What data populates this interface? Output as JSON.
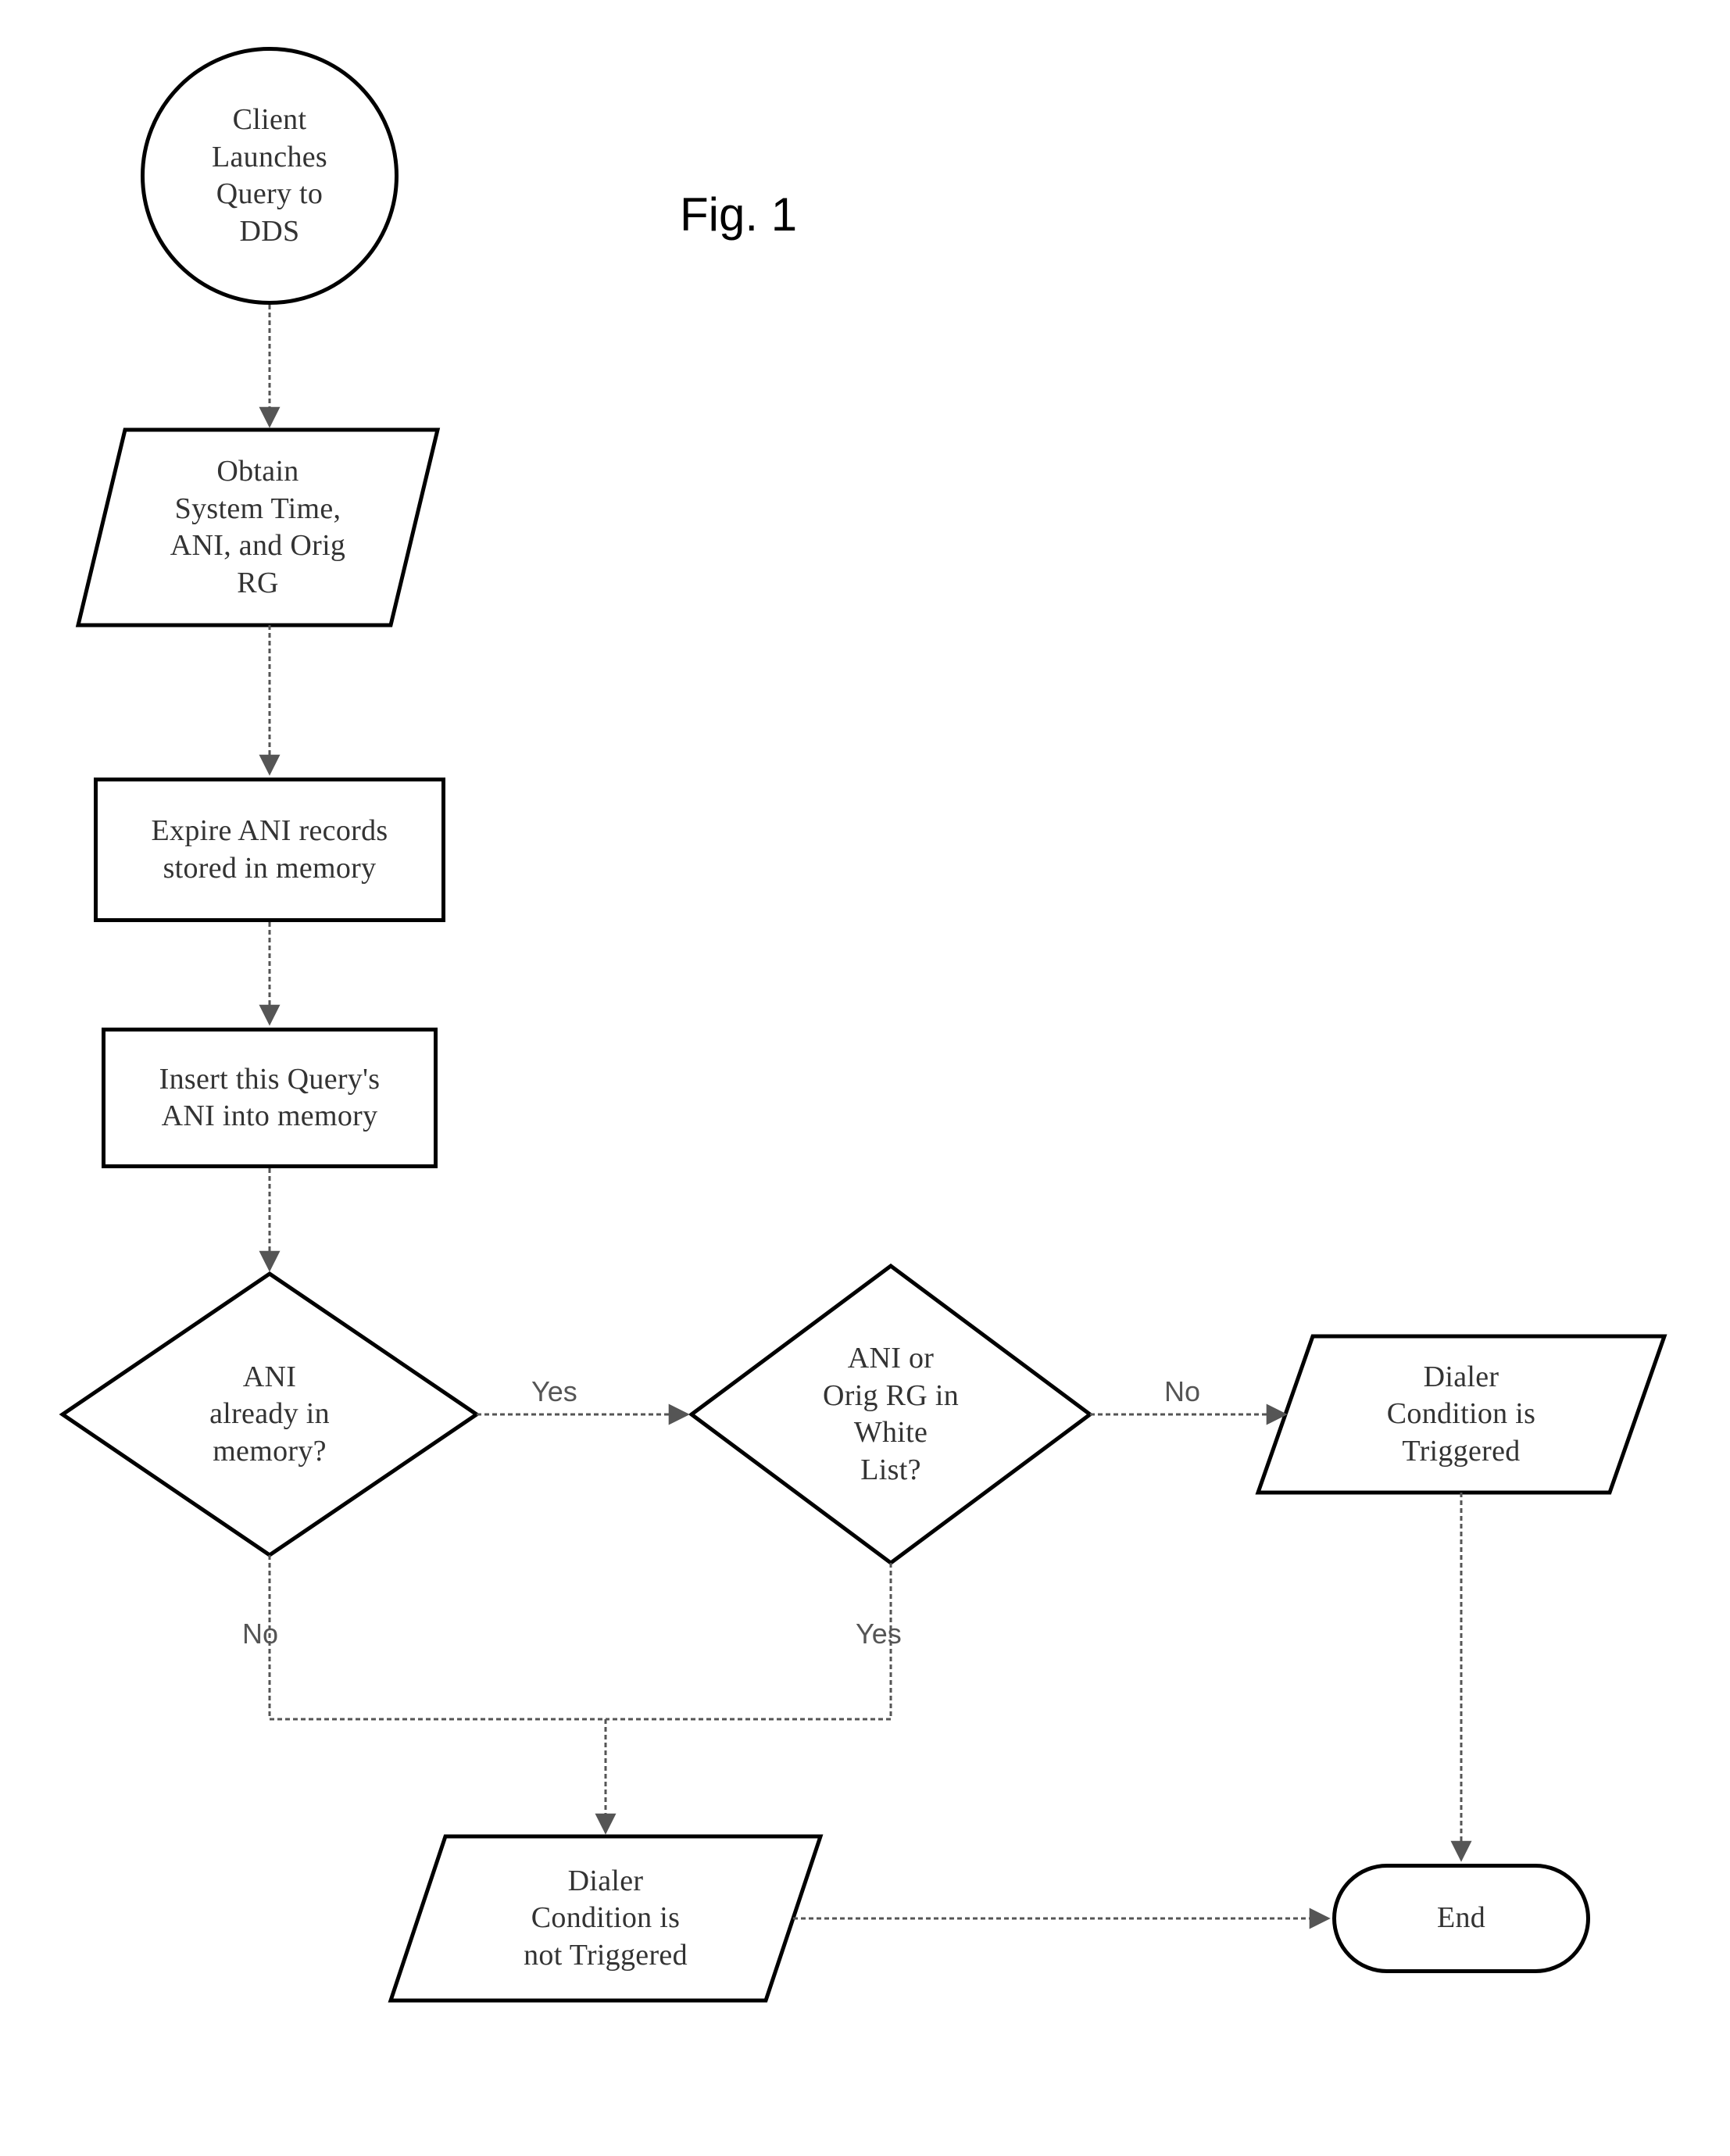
{
  "figure_title": "Fig. 1",
  "nodes": {
    "start": "Client\nLaunches\nQuery to\nDDS",
    "io_obtain": "Obtain\nSystem Time,\nANI, and Orig\nRG",
    "proc_expire": "Expire ANI records\nstored in memory",
    "proc_insert": "Insert this Query's\nANI into memory",
    "dec_ani": "ANI\nalready in\nmemory?",
    "dec_whitelist": "ANI or\nOrig RG in\nWhite\nList?",
    "io_triggered": "Dialer\nCondition is\nTriggered",
    "io_not_triggered": "Dialer\nCondition is\nnot Triggered",
    "end": "End"
  },
  "edges": {
    "yes1": "Yes",
    "no1": "No",
    "yes2": "Yes",
    "no2": "No"
  },
  "chart_data": {
    "type": "flowchart",
    "title": "Fig. 1",
    "nodes": [
      {
        "id": "start",
        "type": "terminator-start",
        "label": "Client Launches Query to DDS"
      },
      {
        "id": "obtain",
        "type": "io",
        "label": "Obtain System Time, ANI, and Orig RG"
      },
      {
        "id": "expire",
        "type": "process",
        "label": "Expire ANI records stored in memory"
      },
      {
        "id": "insert",
        "type": "process",
        "label": "Insert this Query's ANI into memory"
      },
      {
        "id": "dec_ani",
        "type": "decision",
        "label": "ANI already in memory?"
      },
      {
        "id": "dec_wl",
        "type": "decision",
        "label": "ANI or Orig RG in White List?"
      },
      {
        "id": "trig",
        "type": "io",
        "label": "Dialer Condition is Triggered"
      },
      {
        "id": "nottrig",
        "type": "io",
        "label": "Dialer Condition is not Triggered"
      },
      {
        "id": "end",
        "type": "terminator-end",
        "label": "End"
      }
    ],
    "edges": [
      {
        "from": "start",
        "to": "obtain"
      },
      {
        "from": "obtain",
        "to": "expire"
      },
      {
        "from": "expire",
        "to": "insert"
      },
      {
        "from": "insert",
        "to": "dec_ani"
      },
      {
        "from": "dec_ani",
        "to": "dec_wl",
        "label": "Yes"
      },
      {
        "from": "dec_ani",
        "to": "nottrig",
        "label": "No"
      },
      {
        "from": "dec_wl",
        "to": "trig",
        "label": "No"
      },
      {
        "from": "dec_wl",
        "to": "nottrig",
        "label": "Yes"
      },
      {
        "from": "trig",
        "to": "end"
      },
      {
        "from": "nottrig",
        "to": "end"
      }
    ]
  }
}
